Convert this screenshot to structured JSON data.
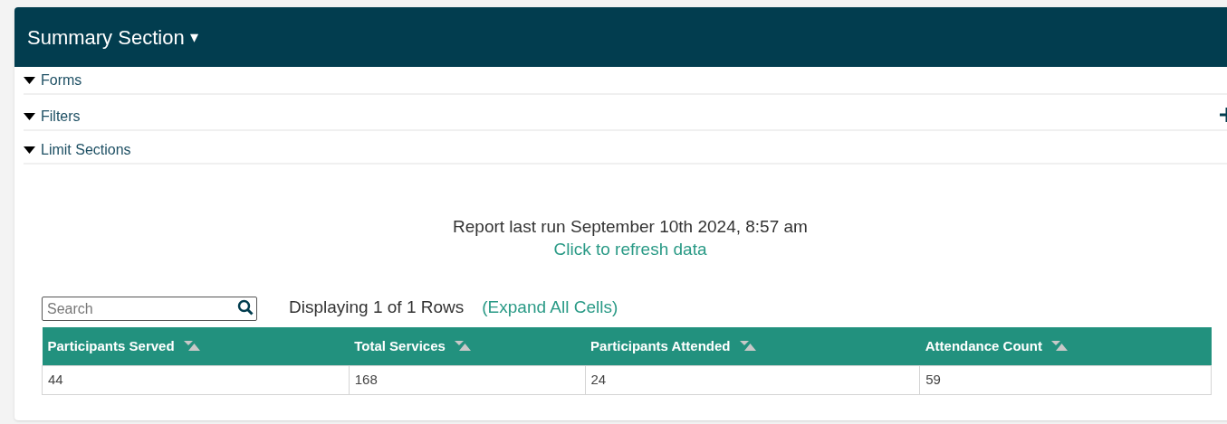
{
  "header": {
    "title": "Summary Section",
    "caret": "▾"
  },
  "sections": [
    {
      "label": "Forms",
      "expanded": true,
      "add_button": false
    },
    {
      "label": "Filters",
      "expanded": true,
      "add_button": true
    },
    {
      "label": "Limit Sections",
      "expanded": true,
      "add_button": false
    }
  ],
  "report": {
    "last_run": "Report last run September 10th 2024, 8:57 am",
    "refresh_link": "Click to refresh data"
  },
  "search": {
    "placeholder": "Search"
  },
  "row_count": "Displaying 1 of 1 Rows",
  "expand_link": "(Expand All Cells)",
  "table": {
    "columns": [
      "Participants Served",
      "Total Services",
      "Participants Attended",
      "Attendance Count"
    ],
    "rows": [
      [
        "44",
        "168",
        "24",
        "59"
      ]
    ]
  }
}
